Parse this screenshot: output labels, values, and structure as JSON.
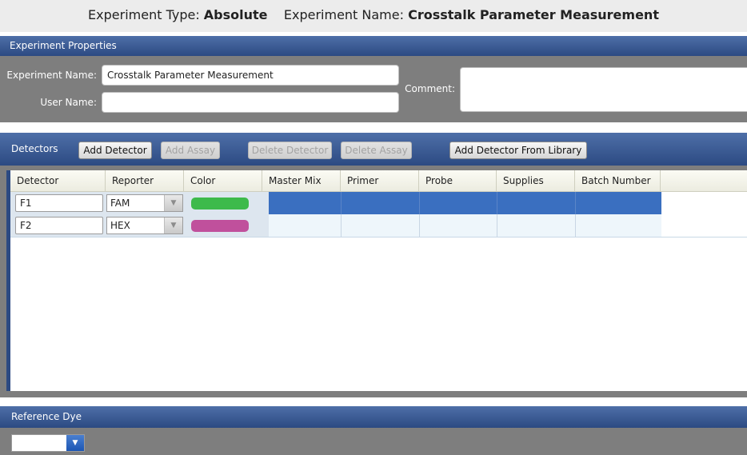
{
  "header": {
    "type_label": "Experiment Type:",
    "type_value": "Absolute",
    "name_label": "Experiment Name:",
    "name_value": "Crosstalk Parameter Measurement"
  },
  "properties": {
    "title": "Experiment Properties",
    "experiment_name_label": "Experiment Name:",
    "experiment_name_value": "Crosstalk Parameter Measurement",
    "user_name_label": "User Name:",
    "user_name_value": "",
    "comment_label": "Comment:",
    "comment_value": ""
  },
  "detectors": {
    "title": "Detectors",
    "buttons": {
      "add_detector": "Add Detector",
      "add_assay": "Add Assay",
      "delete_detector": "Delete Detector",
      "delete_assay": "Delete Assay",
      "add_from_library": "Add Detector From Library"
    },
    "columns": [
      "Detector",
      "Reporter",
      "Color",
      "Master Mix",
      "Primer",
      "Probe",
      "Supplies",
      "Batch Number"
    ],
    "rows": [
      {
        "detector": "F1",
        "reporter": "FAM",
        "color": "#3dba4b"
      },
      {
        "detector": "F2",
        "reporter": "HEX",
        "color": "#c0509c"
      }
    ]
  },
  "reference_dye": {
    "title": "Reference Dye",
    "value": ""
  },
  "colors": {
    "header_blue": "#2c4a82",
    "selected_row": "#3a6fc0",
    "panel_gray": "#7e7e7e"
  }
}
